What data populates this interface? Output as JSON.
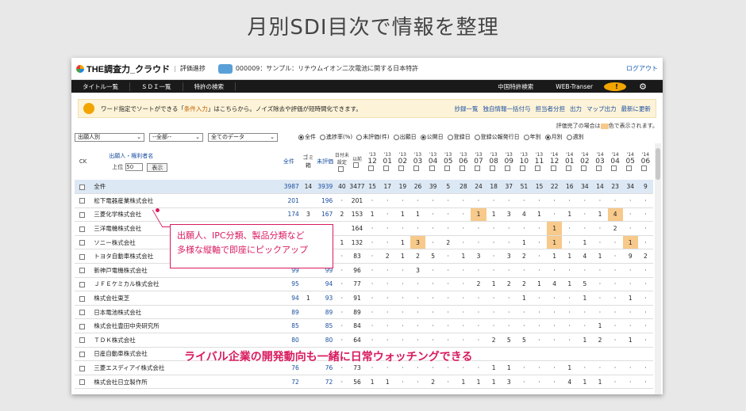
{
  "hero_title": "月別SDI目次で情報を整理",
  "app": {
    "logo": "THE調査力_クラウド",
    "mode": "評価進捗",
    "theme": "000009：サンプル：リチウムイオン二次電池に関する日本特許",
    "logout": "ログアウト"
  },
  "nav": {
    "items": [
      "タイトル一覧",
      "ＳＤＩ一覧",
      "特許の検索"
    ],
    "right": [
      "中国特許検索",
      "WEB-Transer"
    ]
  },
  "info": {
    "text_prefix": "ワード指定でソートができる「",
    "link": "条件入力",
    "text_suffix": "」はこちらから。ノイズ除去や評価が短時間化できます。",
    "actions": [
      "抄録一覧",
      "独自情報一括付与",
      "担当者分担",
      "出力",
      "マップ出力",
      "最新に更新"
    ]
  },
  "note": {
    "before": "評価完了の場合は",
    "after": "色で表示されます。"
  },
  "filters": {
    "group": "出願人別",
    "period": "--全部--",
    "data": "全てのデータ",
    "radios": [
      "全件",
      "進捗率(%)",
      "未評価(件)",
      "出願日",
      "公開日",
      "登録日",
      "登録公報発行日",
      "年別",
      "月別",
      "週別"
    ],
    "radio_on": [
      0,
      4,
      8
    ]
  },
  "table": {
    "ck": "CK",
    "name_header": "出願人・権利者名",
    "top_label": "上位",
    "top_value": "50",
    "show_button": "表示",
    "col_all": "全件",
    "col_trash": "ゴミ箱",
    "col_uneval": "未評価",
    "col_done": "日付未設定",
    "col_pub": "以前",
    "years": [
      "'13",
      "'13",
      "'13",
      "'13",
      "'13",
      "'13",
      "'13",
      "'13",
      "'13",
      "'13",
      "'13",
      "'13",
      "'14",
      "'14",
      "'14",
      "'14",
      "'14",
      "'14",
      "'14"
    ],
    "months": [
      "12",
      "01",
      "02",
      "03",
      "04",
      "05",
      "06",
      "07",
      "08",
      "09",
      "10",
      "11",
      "12",
      "01",
      "02",
      "03",
      "04",
      "05",
      "06"
    ],
    "rows": [
      {
        "name": "全件",
        "all": "3987",
        "trash": "14",
        "un": "3939",
        "d": "40",
        "p": "3477",
        "m": [
          "15",
          "17",
          "19",
          "26",
          "39",
          "5",
          "28",
          "24",
          "18",
          "37",
          "51",
          "15",
          "22",
          "16",
          "34",
          "14",
          "23",
          "34",
          "9"
        ]
      },
      {
        "name": "松下電器産業株式会社",
        "all": "201",
        "trash": "",
        "un": "196",
        "d": "·",
        "p": "201",
        "m": [
          "·",
          "·",
          "·",
          "·",
          "·",
          "·",
          "·",
          "·",
          "·",
          "·",
          "·",
          "·",
          "·",
          "·",
          "·",
          "·",
          "·",
          "·",
          "·"
        ]
      },
      {
        "name": "三菱化学株式会社",
        "all": "174",
        "trash": "3",
        "un": "167",
        "d": "2",
        "p": "153",
        "m": [
          "1",
          "·",
          "1",
          "1",
          "·",
          "·",
          "·",
          "1",
          "1",
          "3",
          "4",
          "1",
          "·",
          "1",
          "·",
          "1",
          "4",
          "·",
          "·"
        ]
      },
      {
        "name": "三洋電機株式会社",
        "all": "",
        "trash": "",
        "un": "",
        "d": "",
        "p": "164",
        "m": [
          "·",
          "·",
          "·",
          "·",
          "·",
          "·",
          "·",
          "·",
          "·",
          "·",
          "·",
          "·",
          "1",
          "·",
          "·",
          "·",
          "2",
          "·",
          "·"
        ]
      },
      {
        "name": "ソニー株式会社",
        "all": "",
        "trash": "",
        "un": "",
        "d": "1",
        "p": "132",
        "m": [
          "·",
          "·",
          "1",
          "3",
          "·",
          "2",
          "·",
          "·",
          "·",
          "·",
          "1",
          "·",
          "1",
          "·",
          "1",
          "·",
          "·",
          "1",
          "·"
        ]
      },
      {
        "name": "トヨタ自動車株式会社",
        "all": "",
        "trash": "",
        "un": "",
        "d": "·",
        "p": "83",
        "m": [
          "·",
          "2",
          "1",
          "2",
          "5",
          "·",
          "1",
          "3",
          "·",
          "3",
          "2",
          "·",
          "1",
          "1",
          "4",
          "1",
          "·",
          "9",
          "2"
        ]
      },
      {
        "name": "新神戸電機株式会社",
        "all": "99",
        "trash": "",
        "un": "99",
        "d": "·",
        "p": "96",
        "m": [
          "·",
          "·",
          "·",
          "3",
          "·",
          "·",
          "·",
          "·",
          "·",
          "·",
          "·",
          "·",
          "·",
          "·",
          "·",
          "·",
          "·",
          "·",
          "·"
        ]
      },
      {
        "name": "ＪＦＥケミカル株式会社",
        "all": "95",
        "trash": "",
        "un": "94",
        "d": "·",
        "p": "77",
        "m": [
          "·",
          "·",
          "·",
          "·",
          "·",
          "·",
          "·",
          "2",
          "1",
          "2",
          "2",
          "1",
          "4",
          "1",
          "5",
          "·",
          "·",
          "·",
          "·"
        ]
      },
      {
        "name": "株式会社東芝",
        "all": "94",
        "trash": "1",
        "un": "93",
        "d": "·",
        "p": "91",
        "m": [
          "·",
          "·",
          "·",
          "·",
          "·",
          "·",
          "·",
          "·",
          "·",
          "·",
          "1",
          "·",
          "·",
          "·",
          "1",
          "·",
          "·",
          "1",
          "·"
        ]
      },
      {
        "name": "日本電池株式会社",
        "all": "89",
        "trash": "",
        "un": "89",
        "d": "·",
        "p": "89",
        "m": [
          "·",
          "·",
          "·",
          "·",
          "·",
          "·",
          "·",
          "·",
          "·",
          "·",
          "·",
          "·",
          "·",
          "·",
          "·",
          "·",
          "·",
          "·",
          "·"
        ]
      },
      {
        "name": "株式会社豊田中央研究所",
        "all": "85",
        "trash": "",
        "un": "85",
        "d": "·",
        "p": "84",
        "m": [
          "·",
          "·",
          "·",
          "·",
          "·",
          "·",
          "·",
          "·",
          "·",
          "·",
          "·",
          "·",
          "·",
          "·",
          "·",
          "1",
          "·",
          "·",
          "·"
        ]
      },
      {
        "name": "ＴＤＫ株式会社",
        "all": "80",
        "trash": "",
        "un": "80",
        "d": "·",
        "p": "64",
        "m": [
          "·",
          "·",
          "·",
          "·",
          "·",
          "·",
          "·",
          "·",
          "2",
          "5",
          "5",
          "·",
          "·",
          "·",
          "1",
          "2",
          "·",
          "1",
          "·"
        ]
      },
      {
        "name": "日産自動車株式会社",
        "all": "",
        "trash": "",
        "un": "",
        "d": "",
        "p": "",
        "m": [
          "",
          "",
          "",
          "",
          "",
          "",
          "",
          "",
          "",
          "",
          "",
          "",
          "",
          "",
          "",
          "",
          "",
          "",
          ""
        ]
      },
      {
        "name": "三菱エスディアイ株式会社",
        "all": "76",
        "trash": "",
        "un": "76",
        "d": "·",
        "p": "73",
        "m": [
          "·",
          "·",
          "·",
          "·",
          "·",
          "·",
          "·",
          "·",
          "1",
          "1",
          "·",
          "·",
          "·",
          "1",
          "·",
          "·",
          "·",
          "·",
          "·"
        ]
      },
      {
        "name": "株式会社日立製作所",
        "all": "72",
        "trash": "",
        "un": "72",
        "d": "·",
        "p": "56",
        "m": [
          "1",
          "1",
          "·",
          "·",
          "2",
          "·",
          "1",
          "1",
          "1",
          "3",
          "·",
          "·",
          "·",
          "4",
          "1",
          "1",
          "·",
          "·",
          "·"
        ]
      }
    ],
    "highlights": [
      [
        2,
        7
      ],
      [
        4,
        3
      ],
      [
        3,
        12
      ],
      [
        4,
        12
      ],
      [
        4,
        17
      ],
      [
        2,
        16
      ]
    ]
  },
  "callout": {
    "line1": "出願人、IPC分類、製品分類など",
    "line2": "多様な縦軸で即座にピックアップ"
  },
  "banner": "ライバル企業の開発動向も一緒に日常ウォッチングできる",
  "colors": {
    "accent": "#d81b60",
    "highlight": "#f7c98a",
    "link": "#1a4fa0"
  }
}
